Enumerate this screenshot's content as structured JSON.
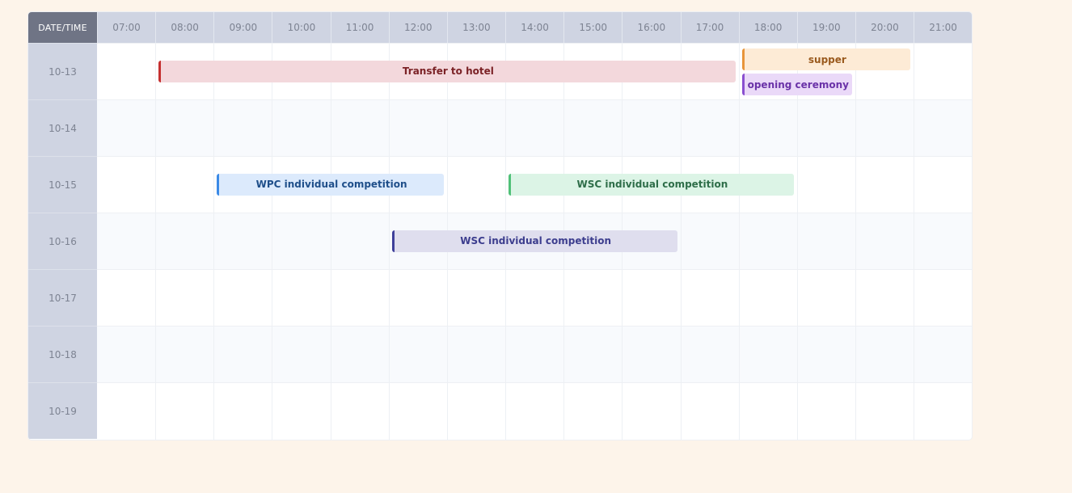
{
  "corner_label": "DATE/TIME",
  "hours": [
    "07:00",
    "08:00",
    "09:00",
    "10:00",
    "11:00",
    "12:00",
    "13:00",
    "14:00",
    "15:00",
    "16:00",
    "17:00",
    "18:00",
    "19:00",
    "20:00",
    "21:00"
  ],
  "dates": [
    "10-13",
    "10-14",
    "10-15",
    "10-16",
    "10-17",
    "10-18",
    "10-19"
  ],
  "events": [
    {
      "label": "Transfer to hotel",
      "date": "10-13",
      "start": "08:00",
      "end": "18:00",
      "color": "#c53030"
    },
    {
      "label": "supper",
      "date": "10-13",
      "start": "18:00",
      "end": "21:00",
      "color": "#e8953a"
    },
    {
      "label": "opening ceremony",
      "date": "10-13",
      "start": "18:00",
      "end": "20:00",
      "color": "#8a4fd0"
    },
    {
      "label": "WPC individual competition",
      "date": "10-15",
      "start": "09:00",
      "end": "13:00",
      "color": "#3b8ae6"
    },
    {
      "label": "WSC individual competition",
      "date": "10-15",
      "start": "14:00",
      "end": "19:00",
      "color": "#4fc078"
    },
    {
      "label": "WSC individual competition",
      "date": "10-16",
      "start": "12:00",
      "end": "17:00",
      "color": "#3e3f9a"
    }
  ]
}
